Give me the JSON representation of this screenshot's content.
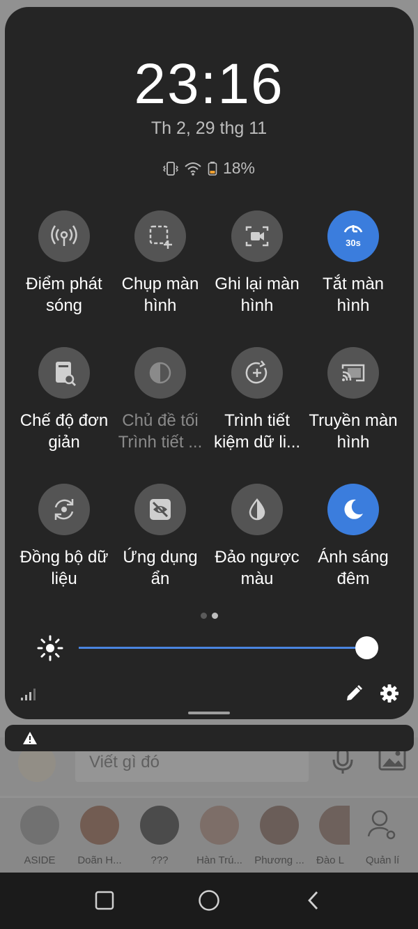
{
  "lockscreen": {
    "time": "23:16",
    "date": "Th 2, 29 thg 11",
    "battery_text": "18%"
  },
  "tiles": [
    {
      "label": "Điểm phát sóng",
      "icon": "hotspot-icon",
      "active": false,
      "dim": false
    },
    {
      "label": "Chụp màn hình",
      "icon": "screenshot-icon",
      "active": false,
      "dim": false
    },
    {
      "label": "Ghi lại màn hình",
      "icon": "screen-record-icon",
      "active": false,
      "dim": false
    },
    {
      "label": "Tắt màn hình",
      "icon": "screen-timeout-icon",
      "active": true,
      "dim": false
    },
    {
      "label": "Chế độ đơn giản",
      "icon": "easy-mode-icon",
      "active": false,
      "dim": false
    },
    {
      "label": "Chủ đề tối Trình tiết ...",
      "icon": "dark-theme-icon",
      "active": false,
      "dim": true
    },
    {
      "label": "Trình tiết kiệm dữ li...",
      "icon": "data-saver-icon",
      "active": false,
      "dim": false
    },
    {
      "label": "Truyền màn hình",
      "icon": "cast-icon",
      "active": false,
      "dim": false
    },
    {
      "label": "Đồng bộ dữ liệu",
      "icon": "sync-icon",
      "active": false,
      "dim": false
    },
    {
      "label": "Ứng dụng ẩn",
      "icon": "hidden-apps-icon",
      "active": false,
      "dim": false
    },
    {
      "label": "Đảo ngược màu",
      "icon": "invert-colors-icon",
      "active": false,
      "dim": false
    },
    {
      "label": "Ánh sáng đêm",
      "icon": "night-light-icon",
      "active": true,
      "dim": false
    }
  ],
  "tile_lines": [
    [
      "Điểm phát",
      "sóng"
    ],
    [
      "Chụp màn",
      "hình"
    ],
    [
      "Ghi lại màn",
      "hình"
    ],
    [
      "Tắt màn",
      "hình"
    ],
    [
      "Chế độ đơn",
      "giản"
    ],
    [
      "Chủ đề tối",
      "Trình tiết ..."
    ],
    [
      "Trình tiết",
      "kiệm dữ li..."
    ],
    [
      "Truyền màn",
      "hình"
    ],
    [
      "Đồng bộ dữ",
      "liệu"
    ],
    [
      "Ứng dụng",
      "ẩn"
    ],
    [
      "Đảo ngược",
      "màu"
    ],
    [
      "Ánh sáng",
      "đêm"
    ]
  ],
  "screen_timeout_badge": "30s",
  "brightness": {
    "level": 0.98
  },
  "pager": {
    "pages": 2,
    "current": 2
  },
  "background_app": {
    "input_placeholder": "Viết gì đó",
    "contacts": [
      "ASIDE",
      "Doãn H...",
      "???",
      "Hàn Trú...",
      "Phương ...",
      "Đào L",
      "Quản lí"
    ]
  },
  "colors": {
    "panel": "#252525",
    "tile_inactive": "#545454",
    "tile_active": "#3b7ddd",
    "slider": "#4a85e0"
  }
}
